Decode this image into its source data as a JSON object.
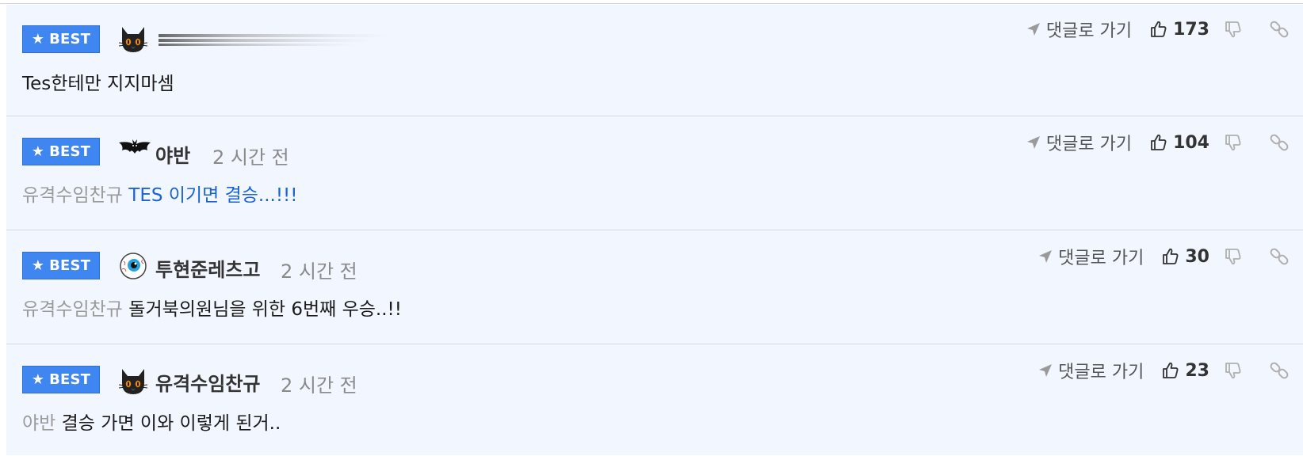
{
  "comments": [
    {
      "badge": "BEST",
      "avatar_icon": "black-cat-icon",
      "author": "",
      "time": "",
      "mention": "",
      "text": "Tes한테만 지지마셈",
      "text_style": "normal",
      "goto_label": "댓글로 가기",
      "likes": "173"
    },
    {
      "badge": "BEST",
      "avatar_icon": "bat-icon",
      "author": "야반",
      "time": "2 시간 전",
      "mention": "유격수임찬규",
      "text": "TES 이기면 결승...!!!",
      "text_style": "link",
      "goto_label": "댓글로 가기",
      "likes": "104"
    },
    {
      "badge": "BEST",
      "avatar_icon": "eyeball-icon",
      "author": "투현준레츠고",
      "time": "2 시간 전",
      "mention": "유격수임찬규",
      "text": "돌거북의원님을 위한 6번째 우승..!!",
      "text_style": "normal",
      "goto_label": "댓글로 가기",
      "likes": "30"
    },
    {
      "badge": "BEST",
      "avatar_icon": "black-cat-icon",
      "author": "유격수임찬규",
      "time": "2 시간 전",
      "mention": "야반",
      "text": "결승 가면 이와 이렇게 된거..",
      "text_style": "normal",
      "goto_label": "댓글로 가기",
      "likes": "23"
    }
  ],
  "colors": {
    "badge_blue": "#3f86f0",
    "row_background": "#f1f6ff",
    "link_blue": "#1a63d6",
    "mention_gray": "#9a9a9a"
  }
}
